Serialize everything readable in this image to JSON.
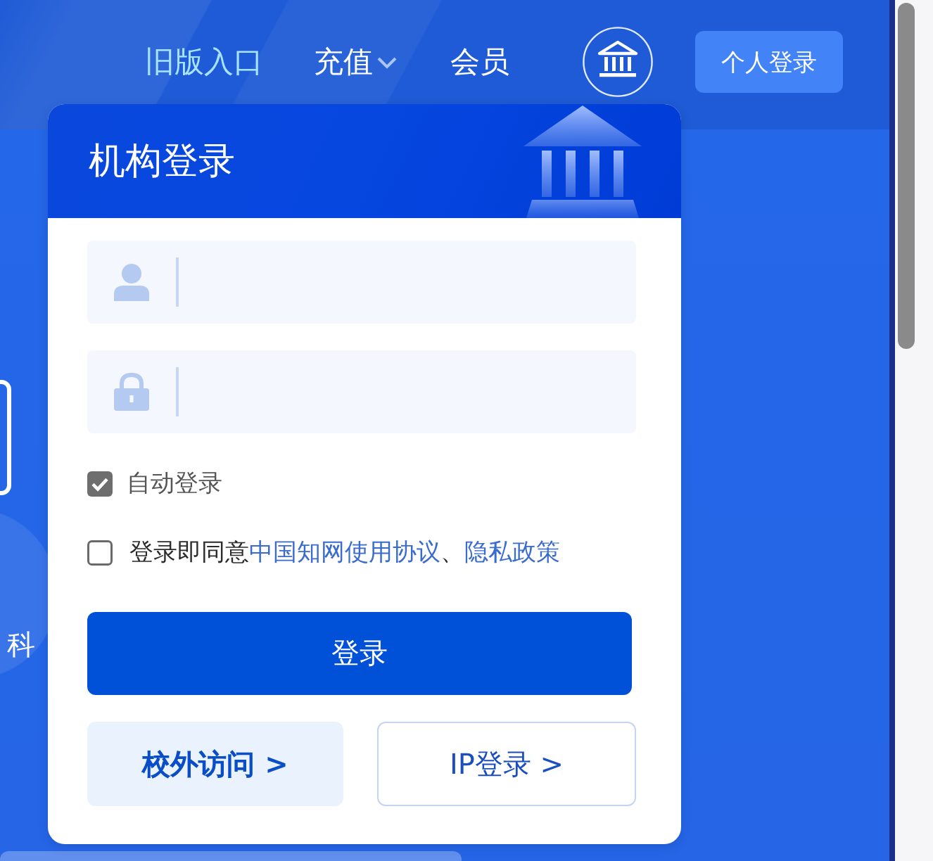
{
  "header": {
    "nav": [
      {
        "label": "旧版入口",
        "highlighted": true,
        "dropdown": false
      },
      {
        "label": "充值",
        "highlighted": false,
        "dropdown": true
      },
      {
        "label": "会员",
        "highlighted": false,
        "dropdown": false
      }
    ],
    "login_button": "个人登录"
  },
  "background": {
    "text": "科"
  },
  "login_panel": {
    "title": "机构登录",
    "fields": [
      {
        "kind": "user"
      },
      {
        "kind": "password"
      }
    ],
    "checkboxes": [
      {
        "kind": "option",
        "checked": true,
        "parts": [
          {
            "kind": "text",
            "text": "自动登录"
          }
        ]
      },
      {
        "kind": "agreement",
        "checked": false,
        "parts": [
          {
            "kind": "text",
            "text": "登录即同意"
          },
          {
            "kind": "link",
            "text": "中国知网使用协议"
          },
          {
            "kind": "text",
            "text": "、"
          },
          {
            "kind": "link",
            "text": "隐私政策"
          }
        ]
      }
    ],
    "submit": "登录",
    "alt_buttons": [
      {
        "kind": "offcampus",
        "label": "校外访问 >"
      },
      {
        "kind": "ip",
        "label": "IP登录 >"
      }
    ]
  }
}
